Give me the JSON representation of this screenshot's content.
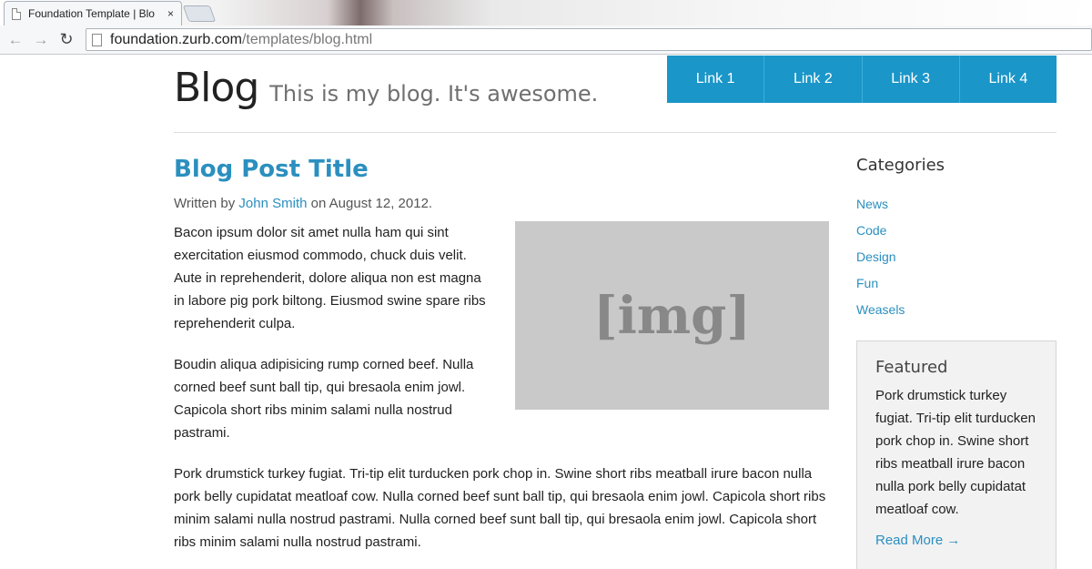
{
  "browser": {
    "tab_title": "Foundation Template | Blo",
    "tab_close": "×",
    "url_host": "foundation.zurb.com",
    "url_path": "/templates/blog.html",
    "back_icon": "←",
    "forward_icon": "→",
    "reload_icon": "↻"
  },
  "header": {
    "title": "Blog",
    "tagline": "This is my blog. It's awesome.",
    "nav": [
      "Link 1",
      "Link 2",
      "Link 3",
      "Link 4"
    ]
  },
  "post": {
    "title": "Blog Post Title",
    "byline_prefix": "Written by ",
    "author": "John Smith",
    "byline_suffix": " on August 12, 2012.",
    "image_label": "[img]",
    "paragraphs": [
      "Bacon ipsum dolor sit amet nulla ham qui sint exercitation eiusmod commodo, chuck duis velit. Aute in reprehenderit, dolore aliqua non est magna in labore pig pork biltong. Eiusmod swine spare ribs reprehenderit culpa.",
      "Boudin aliqua adipisicing rump corned beef. Nulla corned beef sunt ball tip, qui bresaola enim jowl. Capicola short ribs minim salami nulla nostrud pastrami.",
      "Pork drumstick turkey fugiat. Tri-tip elit turducken pork chop in. Swine short ribs meatball irure bacon nulla pork belly cupidatat meatloaf cow. Nulla corned beef sunt ball tip, qui bresaola enim jowl. Capicola short ribs minim salami nulla nostrud pastrami. Nulla corned beef sunt ball tip, qui bresaola enim jowl. Capicola short ribs minim salami nulla nostrud pastrami."
    ]
  },
  "sidebar": {
    "title": "Categories",
    "categories": [
      "News",
      "Code",
      "Design",
      "Fun",
      "Weasels"
    ],
    "featured": {
      "title": "Featured",
      "text": "Pork drumstick turkey fugiat. Tri-tip elit turducken pork chop in. Swine short ribs meatball irure bacon nulla pork belly cupidatat meatloaf cow.",
      "more": "Read More →"
    }
  },
  "colors": {
    "accent": "#1a96c8",
    "link": "#2b8fbf",
    "image_placeholder": "#c9c9c9"
  }
}
